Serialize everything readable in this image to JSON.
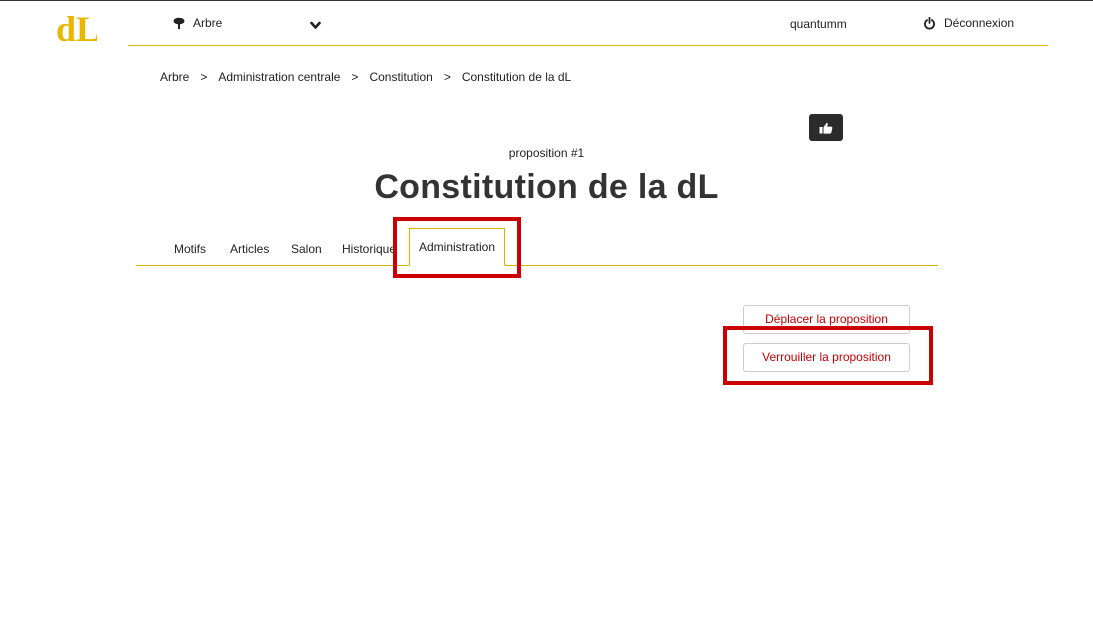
{
  "header": {
    "logo_text": "dL",
    "tree_label": "Arbre",
    "user_name": "quantumm",
    "logout_label": "Déconnexion"
  },
  "breadcrumb": [
    "Arbre",
    "Administration centrale",
    "Constitution",
    "Constitution de la dL"
  ],
  "breadcrumb_separator": ">",
  "proposal": {
    "number_label": "proposition #1",
    "title": "Constitution de la dL"
  },
  "tabs": [
    "Motifs",
    "Articles",
    "Salon",
    "Historique",
    "Administration"
  ],
  "active_tab": "Administration",
  "actions": {
    "move_label": "Déplacer la proposition",
    "lock_label": "Verrouiller la proposition"
  },
  "colors": {
    "accent": "#d9b400",
    "danger_text": "#c40000",
    "highlight": "#cc0000"
  }
}
